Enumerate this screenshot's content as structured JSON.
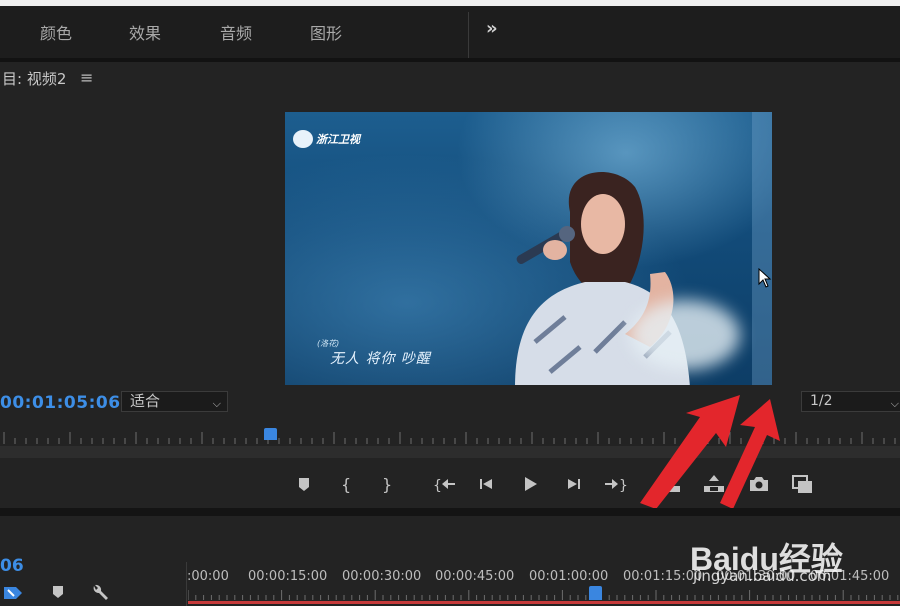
{
  "workspace_tabs": [
    "颜色",
    "效果",
    "音频",
    "图形"
  ],
  "more_label": "»",
  "panel": {
    "title": "目: 视频2",
    "menu_icon": "≡"
  },
  "video": {
    "channel_logo": "浙江卫视",
    "subtitle_tag": "(洛花)",
    "subtitle": "无人 将你 吵醒"
  },
  "monitor": {
    "timecode": "00:01:05:06",
    "fit_value": "适合",
    "resolution_value": "1/2"
  },
  "transport_buttons": [
    "add-marker",
    "mark-in",
    "mark-out",
    "go-to-in",
    "step-back",
    "play",
    "step-forward",
    "go-to-out",
    "lift",
    "extract",
    "export-frame",
    "button-editor"
  ],
  "timeline": {
    "timecode": "06",
    "ruler_labels": [
      ":00:00",
      "00:00:15:00",
      "00:00:30:00",
      "00:00:45:00",
      "00:01:00:00",
      "00:01:15:00",
      "00:01:30:00",
      "00:01:45:00"
    ]
  },
  "watermark": {
    "brand": "Baidu经验",
    "url": "jingyan.baidu.com"
  },
  "colors": {
    "accent_blue": "#3d8ee6",
    "annotation_red": "#e3262c",
    "timeline_red": "#c63b3b"
  }
}
